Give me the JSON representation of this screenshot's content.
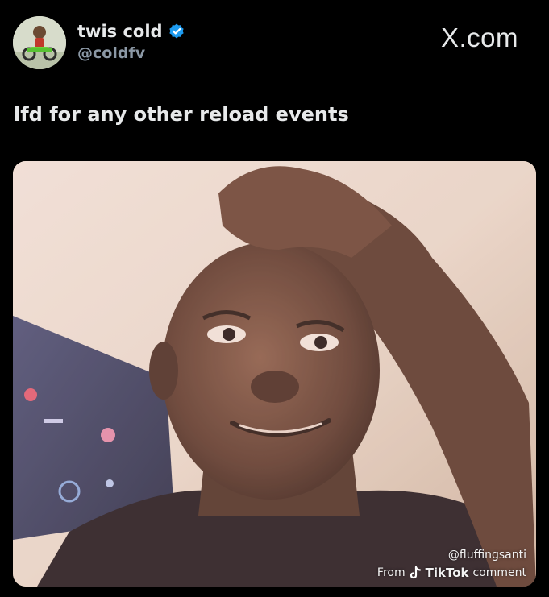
{
  "author": {
    "display_name": "twis cold",
    "handle": "@coldfv",
    "verified": true,
    "verified_color": "#1d9bf0"
  },
  "brand": {
    "label": "X.com"
  },
  "post": {
    "text": "lfd for any other reload events"
  },
  "media": {
    "watermark_handle": "@fluffingsanti",
    "source_prefix": "From",
    "source_app": "TikTok",
    "source_suffix": "comment"
  },
  "colors": {
    "background": "#000000",
    "text_primary": "#e7e9ea",
    "text_secondary": "#8b98a5",
    "verified_blue": "#1d9bf0"
  },
  "icons": {
    "verified": "verified-badge-icon",
    "brand": "x-logo-icon",
    "source_app": "tiktok-icon"
  }
}
